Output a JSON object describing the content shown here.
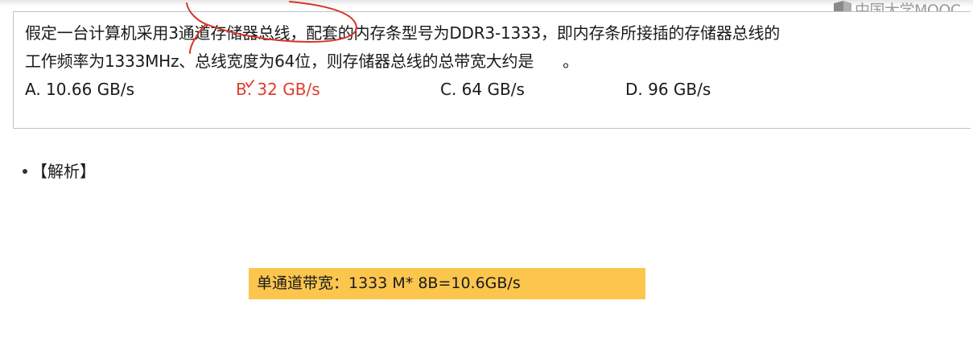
{
  "watermark": {
    "text": "中国大学MOOC",
    "logo_icon": "mooc-logo-icon"
  },
  "question": {
    "line1": "假定一台计算机采用3通道存储器总线，配套的内存条型号为DDR3-1333，即内存条所接插的存储器总线的",
    "line2_before_blank": "工作频率为1333MHz、总线宽度为64位，则存储器总线的总带宽大约是",
    "line2_after_blank": "。",
    "options": [
      {
        "label": "A. 10.66 GB/s",
        "selected": false
      },
      {
        "label": "B. 32 GB/s",
        "selected": true
      },
      {
        "label": "C. 64 GB/s",
        "selected": false
      },
      {
        "label": "D. 96 GB/s",
        "selected": false
      }
    ]
  },
  "analysis": {
    "label": "【解析】"
  },
  "highlight": {
    "text": "单通道带宽：1333 M* 8B=10.6GB/s"
  },
  "colors": {
    "answer_red": "#e23b2e",
    "highlight_yellow": "#fcc64e",
    "box_border": "#b9c4d0",
    "watermark_gray": "#9a9a9a"
  }
}
